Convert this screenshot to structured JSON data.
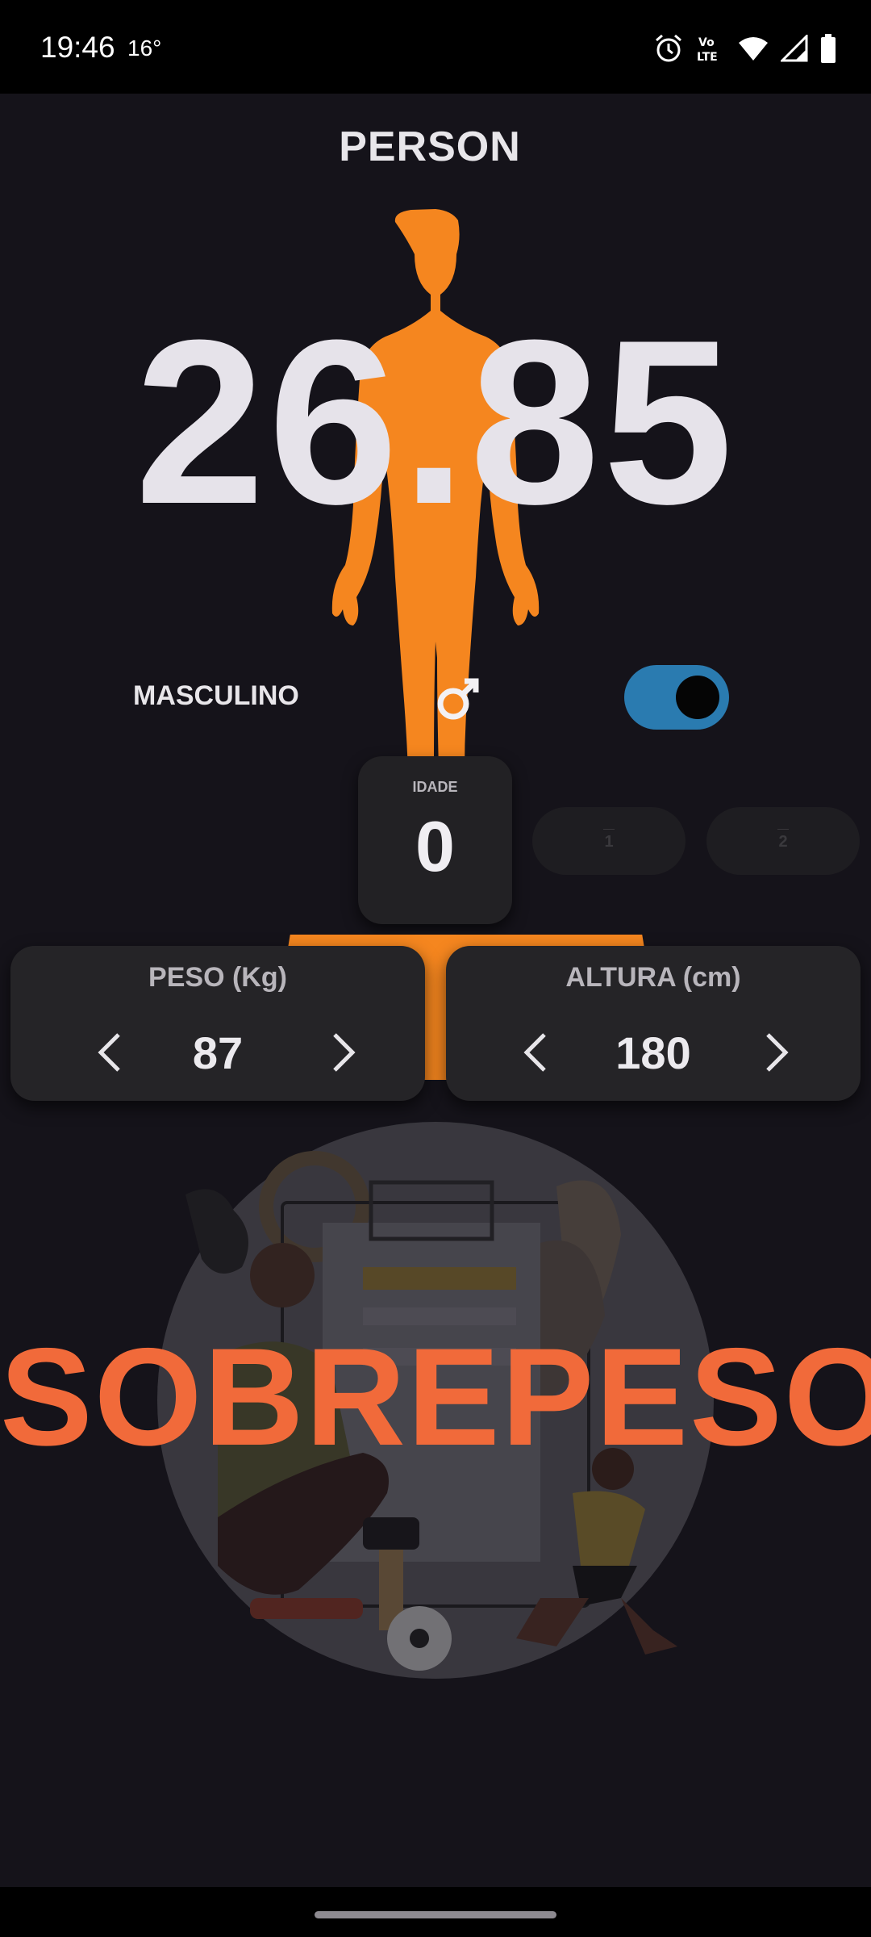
{
  "status_bar": {
    "time": "19:46",
    "temperature": "16°"
  },
  "app": {
    "title": "PERSON"
  },
  "bmi": {
    "value": "26.85"
  },
  "gender": {
    "label": "MASCULINO",
    "toggle_on": true
  },
  "age": {
    "label": "IDADE",
    "value": "0",
    "next_options": [
      {
        "dash": "—",
        "value": "1"
      },
      {
        "dash": "—",
        "value": "2"
      }
    ]
  },
  "weight": {
    "label": "PESO (Kg)",
    "value": "87"
  },
  "height": {
    "label": "ALTURA (cm)",
    "value": "180"
  },
  "result": {
    "label": "SOBREPESO"
  },
  "colors": {
    "background": "#15131a",
    "accent": "#f5861f",
    "result": "#f16a3a",
    "toggle": "#2a7bb0"
  }
}
